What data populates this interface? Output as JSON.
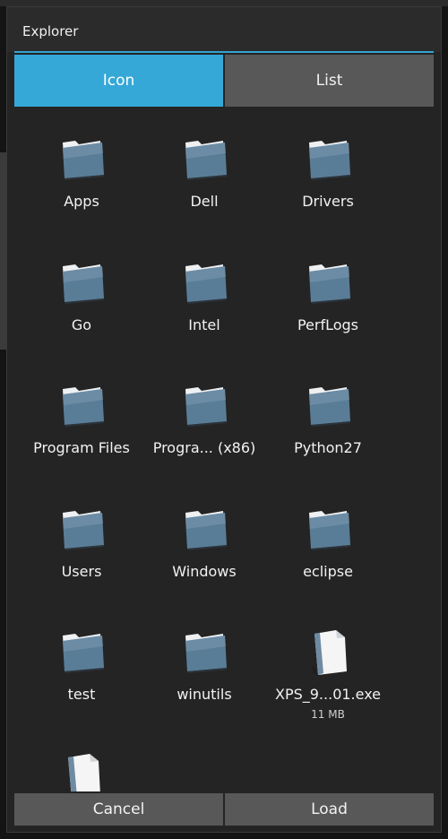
{
  "window": {
    "title": "Explorer"
  },
  "view_tabs": [
    {
      "label": "Icon",
      "active": true
    },
    {
      "label": "List",
      "active": false
    }
  ],
  "items": [
    {
      "name": "Apps",
      "type": "folder"
    },
    {
      "name": "Dell",
      "type": "folder"
    },
    {
      "name": "Drivers",
      "type": "folder"
    },
    {
      "name": "Go",
      "type": "folder"
    },
    {
      "name": "Intel",
      "type": "folder"
    },
    {
      "name": "PerfLogs",
      "type": "folder"
    },
    {
      "name": "Program Files",
      "type": "folder"
    },
    {
      "name": "Progra... (x86)",
      "type": "folder"
    },
    {
      "name": "Python27",
      "type": "folder"
    },
    {
      "name": "Users",
      "type": "folder"
    },
    {
      "name": "Windows",
      "type": "folder"
    },
    {
      "name": "eclipse",
      "type": "folder"
    },
    {
      "name": "test",
      "type": "folder"
    },
    {
      "name": "winutils",
      "type": "folder"
    },
    {
      "name": "XPS_9...01.exe",
      "type": "file",
      "size": "11 MB"
    },
    {
      "name": "",
      "type": "file"
    }
  ],
  "buttons": {
    "cancel": "Cancel",
    "load": "Load"
  },
  "colors": {
    "accent": "#35a8d8",
    "dialog_bg": "#242424",
    "button_bg": "#585858",
    "folder_front": "#5a7d97",
    "folder_back": "#eef0f2",
    "file_page": "#f5f5f5",
    "file_spine": "#6f8ba3"
  },
  "icons": {
    "folder": "folder-icon",
    "file": "file-icon"
  }
}
